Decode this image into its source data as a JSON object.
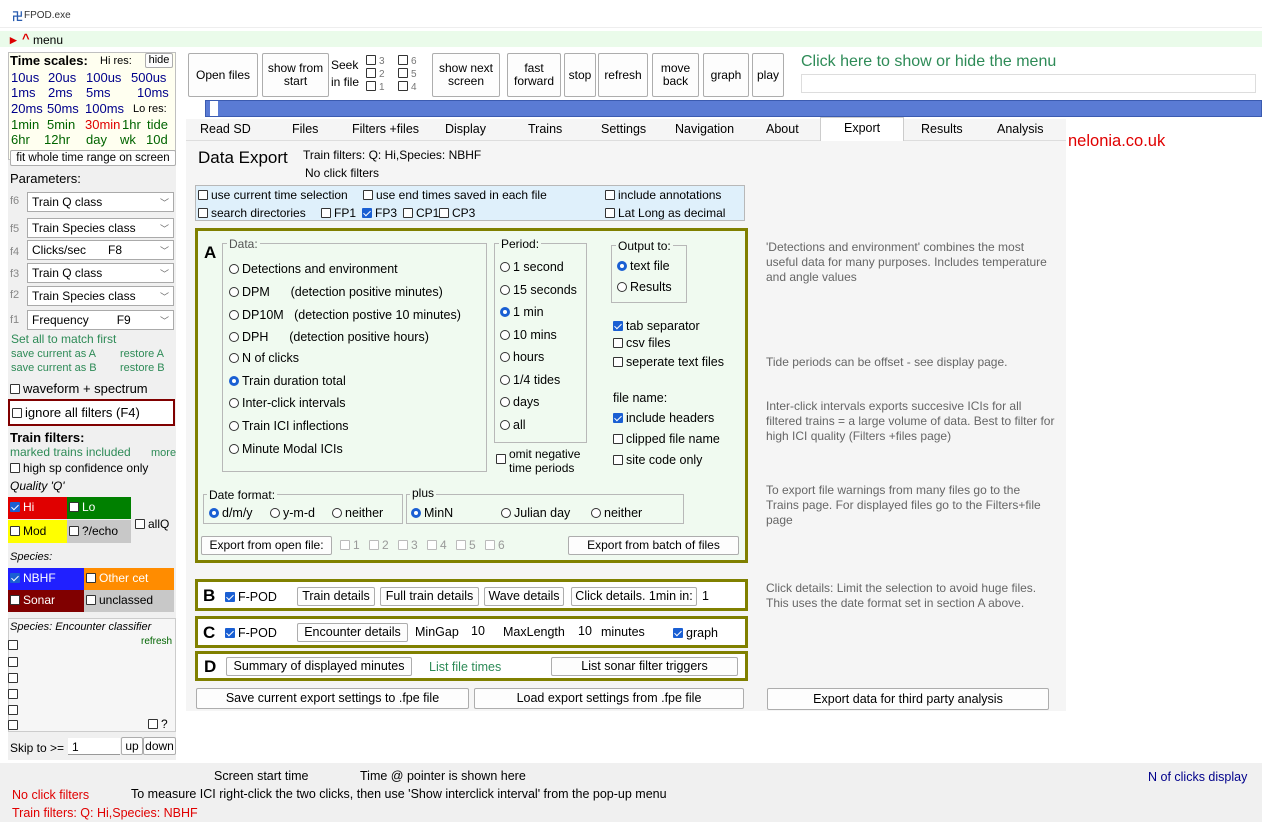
{
  "window": {
    "title": "FPOD.exe"
  },
  "menu": {
    "label": "menu"
  },
  "left": {
    "time_scales_title": "Time scales:",
    "hi_res": "Hi res:",
    "hide": "hide",
    "row1": [
      "10us",
      "20us",
      "100us",
      "500us"
    ],
    "row2": [
      "1ms",
      "2ms",
      "5ms",
      "10ms"
    ],
    "row3": [
      "20ms",
      "50ms",
      "100ms",
      "Lo res:"
    ],
    "row4": [
      "1min",
      "5min",
      "30min",
      "1hr",
      "tide"
    ],
    "row5": [
      "6hr",
      "12hr",
      "day",
      "wk",
      "10d"
    ],
    "fit_button": "fit whole time range on screen",
    "parameters_title": "Parameters:",
    "params": [
      {
        "f": "f6",
        "label": "Train Q class",
        "key": ""
      },
      {
        "f": "f5",
        "label": "Train Species class",
        "key": ""
      },
      {
        "f": "f4",
        "label": "Clicks/sec",
        "key": "F8"
      },
      {
        "f": "f3",
        "label": "Train Q class",
        "key": ""
      },
      {
        "f": "f2",
        "label": "Train Species class",
        "key": ""
      },
      {
        "f": "f1",
        "label": "Frequency",
        "key": "F9"
      }
    ],
    "set_all": "Set all to match first",
    "save_a": "save current as A",
    "restore_a": "restore A",
    "save_b": "save current as B",
    "restore_b": "restore B",
    "waveform": "waveform + spectrum",
    "ignore_filters": "ignore all filters (F4)",
    "train_filters_title": "Train filters:",
    "marked_trains": "marked trains included",
    "more": "more",
    "high_sp": "high sp confidence only",
    "quality": "Quality 'Q'",
    "q_hi": "Hi",
    "q_lo": "Lo",
    "q_mod": "Mod",
    "q_echo": "?/echo",
    "allq": "allQ",
    "species_title": "Species:",
    "sp_nbhf": "NBHF",
    "sp_other": "Other cet",
    "sp_sonar": "Sonar",
    "sp_unclassed": "unclassed",
    "encounter_title": "Species: Encounter classifier",
    "refresh": "refresh",
    "q2": "?",
    "skip_label": "Skip to >=",
    "skip_value": "1",
    "up": "up",
    "down": "down"
  },
  "toolbar": {
    "open_files": "Open files",
    "show_from_start": "show from start",
    "seek_in_file": "Seek in file",
    "seek_nums": [
      "3",
      "6",
      "2",
      "5",
      "1",
      "4"
    ],
    "show_next_screen": "show next screen",
    "fast_forward": "fast forward",
    "stop": "stop",
    "refresh": "refresh",
    "move_back": "move back",
    "graph": "graph",
    "play": "play",
    "menu_hint": "Click here to show or hide the menu"
  },
  "tabs": [
    "Read SD",
    "Files",
    "Filters +files",
    "Display",
    "Trains",
    "Settings",
    "Navigation",
    "About",
    "Export",
    "Results",
    "Analysis"
  ],
  "site_text": "nelonia.co.uk",
  "export": {
    "title": "Data Export",
    "train_filters": "Train filters: Q: Hi,Species: NBHF",
    "click_filters": "No click filters",
    "use_current": "use current time selection",
    "use_end_times": "use end times saved in each file",
    "include_annotations": "include annotations",
    "search_dirs": "search directories",
    "fp1": "FP1",
    "fp3": "FP3",
    "cp1": "CP1",
    "cp3": "CP3",
    "latlong": "Lat Long as decimal",
    "A": {
      "letter": "A",
      "data_label": "Data:",
      "data_options": [
        "Detections and environment",
        "DPM      (detection positive minutes)",
        "DP10M   (detection postive 10 minutes)",
        "DPH      (detection positive hours)",
        "N of clicks",
        "Train duration total",
        "Inter-click intervals",
        "Train ICI inflections",
        "Minute Modal ICIs"
      ],
      "period_label": "Period:",
      "periods": [
        "1 second",
        "15 seconds",
        "1 min",
        "10 mins",
        "hours",
        "1/4 tides",
        "days",
        "all"
      ],
      "omit_negative": "omit negative time periods",
      "output_label": "Output to:",
      "output_text": "text file",
      "output_results": "Results",
      "tab_sep": "tab separator",
      "csv": "csv files",
      "separate": "seperate text files",
      "file_name": "file name:",
      "include_headers": "include headers",
      "clipped": "clipped file name",
      "site_code": "site code only",
      "date_format": "Date format:",
      "dmy": "d/m/y",
      "ymd": "y-m-d",
      "neither": "neither",
      "plus": "plus",
      "minn": "MinN",
      "julian": "Julian day",
      "neither2": "neither",
      "export_open": "Export from open file:",
      "open_nums": [
        "1",
        "2",
        "3",
        "4",
        "5",
        "6"
      ],
      "export_batch": "Export from batch of files"
    },
    "B": {
      "letter": "B",
      "fpod": "F-POD",
      "train_details": "Train details",
      "full_train": "Full train details",
      "wave": "Wave details",
      "click_details": "Click details. 1min in:",
      "click_value": "1"
    },
    "C": {
      "letter": "C",
      "fpod": "F-POD",
      "encounter": "Encounter details",
      "mingap": "MinGap",
      "mingap_val": "10",
      "maxlen": "MaxLength",
      "maxlen_val": "10",
      "minutes": "minutes",
      "graph": "graph"
    },
    "D": {
      "letter": "D",
      "summary": "Summary of displayed minutes",
      "list_times": "List file times",
      "list_sonar": "List sonar filter triggers"
    },
    "save_settings": "Save current export settings to .fpe  file",
    "load_settings": "Load export settings from .fpe file",
    "third_party": "Export data for third party analysis"
  },
  "notes": {
    "n1": "'Detections and environment' combines the most useful data for many purposes. Includes temperature and angle values",
    "n2": "Tide periods can be offset - see display page.",
    "n3": "Inter-click intervals exports succesive ICIs for all filtered trains = a large volume of data. Best to filter for high ICI quality (Filters +files page)",
    "n4": "To export file warnings from many files go to the Trains page. For displayed files go to the Filters+file page",
    "n5": "Click details: Limit the selection to avoid huge files. This uses the date format set in section A above."
  },
  "status": {
    "screen_start": "Screen start time",
    "time_pointer": "Time @ pointer is shown here",
    "n_clicks": "N of clicks display",
    "no_click": "No click filters",
    "measure": "To measure ICI right-click the two clicks, then use 'Show interclick interval' from the pop-up menu",
    "train_filters": "Train filters: Q: Hi,Species: NBHF"
  }
}
